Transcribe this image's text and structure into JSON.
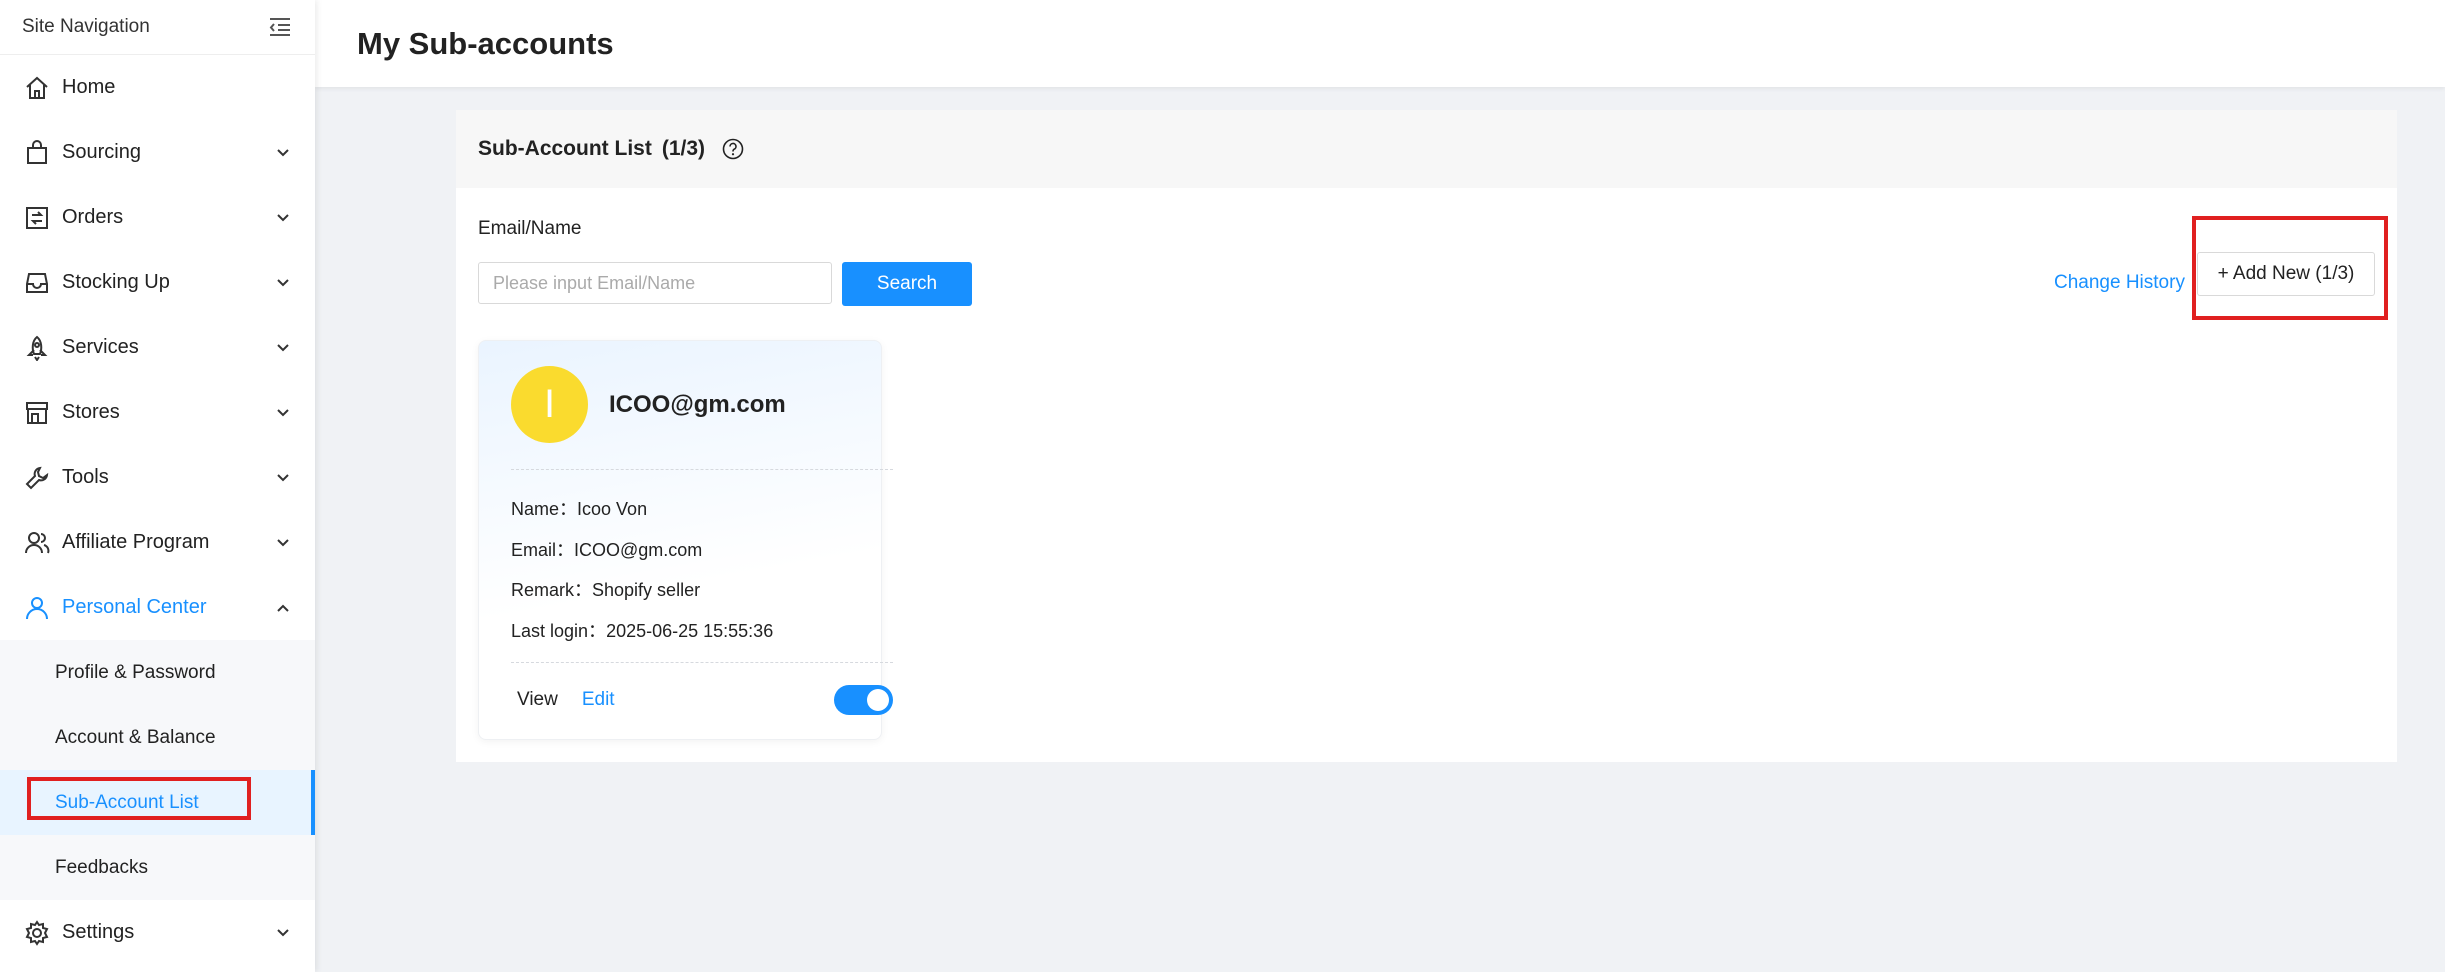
{
  "sidebar": {
    "title": "Site Navigation",
    "items": [
      {
        "label": "Home",
        "icon": "home-icon"
      },
      {
        "label": "Sourcing",
        "icon": "shopping-bag-icon"
      },
      {
        "label": "Orders",
        "icon": "orders-icon"
      },
      {
        "label": "Stocking Up",
        "icon": "inbox-icon"
      },
      {
        "label": "Services",
        "icon": "rocket-icon"
      },
      {
        "label": "Stores",
        "icon": "store-icon"
      },
      {
        "label": "Tools",
        "icon": "wrench-icon"
      },
      {
        "label": "Affiliate Program",
        "icon": "users-icon"
      },
      {
        "label": "Personal Center",
        "icon": "user-icon"
      }
    ],
    "personal_center_items": [
      {
        "label": "Profile & Password"
      },
      {
        "label": "Account & Balance"
      },
      {
        "label": "Sub-Account List"
      },
      {
        "label": "Feedbacks"
      }
    ],
    "settings": {
      "label": "Settings",
      "icon": "gear-icon"
    }
  },
  "header": {
    "title": "My Sub-accounts"
  },
  "panel": {
    "title": "Sub-Account List",
    "count": "(1/3)",
    "filter_label": "Email/Name",
    "search_placeholder": "Please input Email/Name",
    "search_value": "",
    "search_button": "Search",
    "change_history": "Change History",
    "add_new": "+ Add New (1/3)"
  },
  "accounts": [
    {
      "avatar_letter": "I",
      "title": "ICOO@gm.com",
      "name_label": "Name：",
      "name": "Icoo Von",
      "email_label": "Email：",
      "email": "ICOO@gm.com",
      "remark_label": "Remark：",
      "remark": "Shopify seller",
      "last_login_label": "Last login：",
      "last_login": "2025-06-25 15:55:36",
      "view_label": "View",
      "edit_label": "Edit",
      "enabled": true
    }
  ],
  "colors": {
    "accent": "#1890ff",
    "avatar": "#fadb2e",
    "highlight": "#e02020"
  }
}
